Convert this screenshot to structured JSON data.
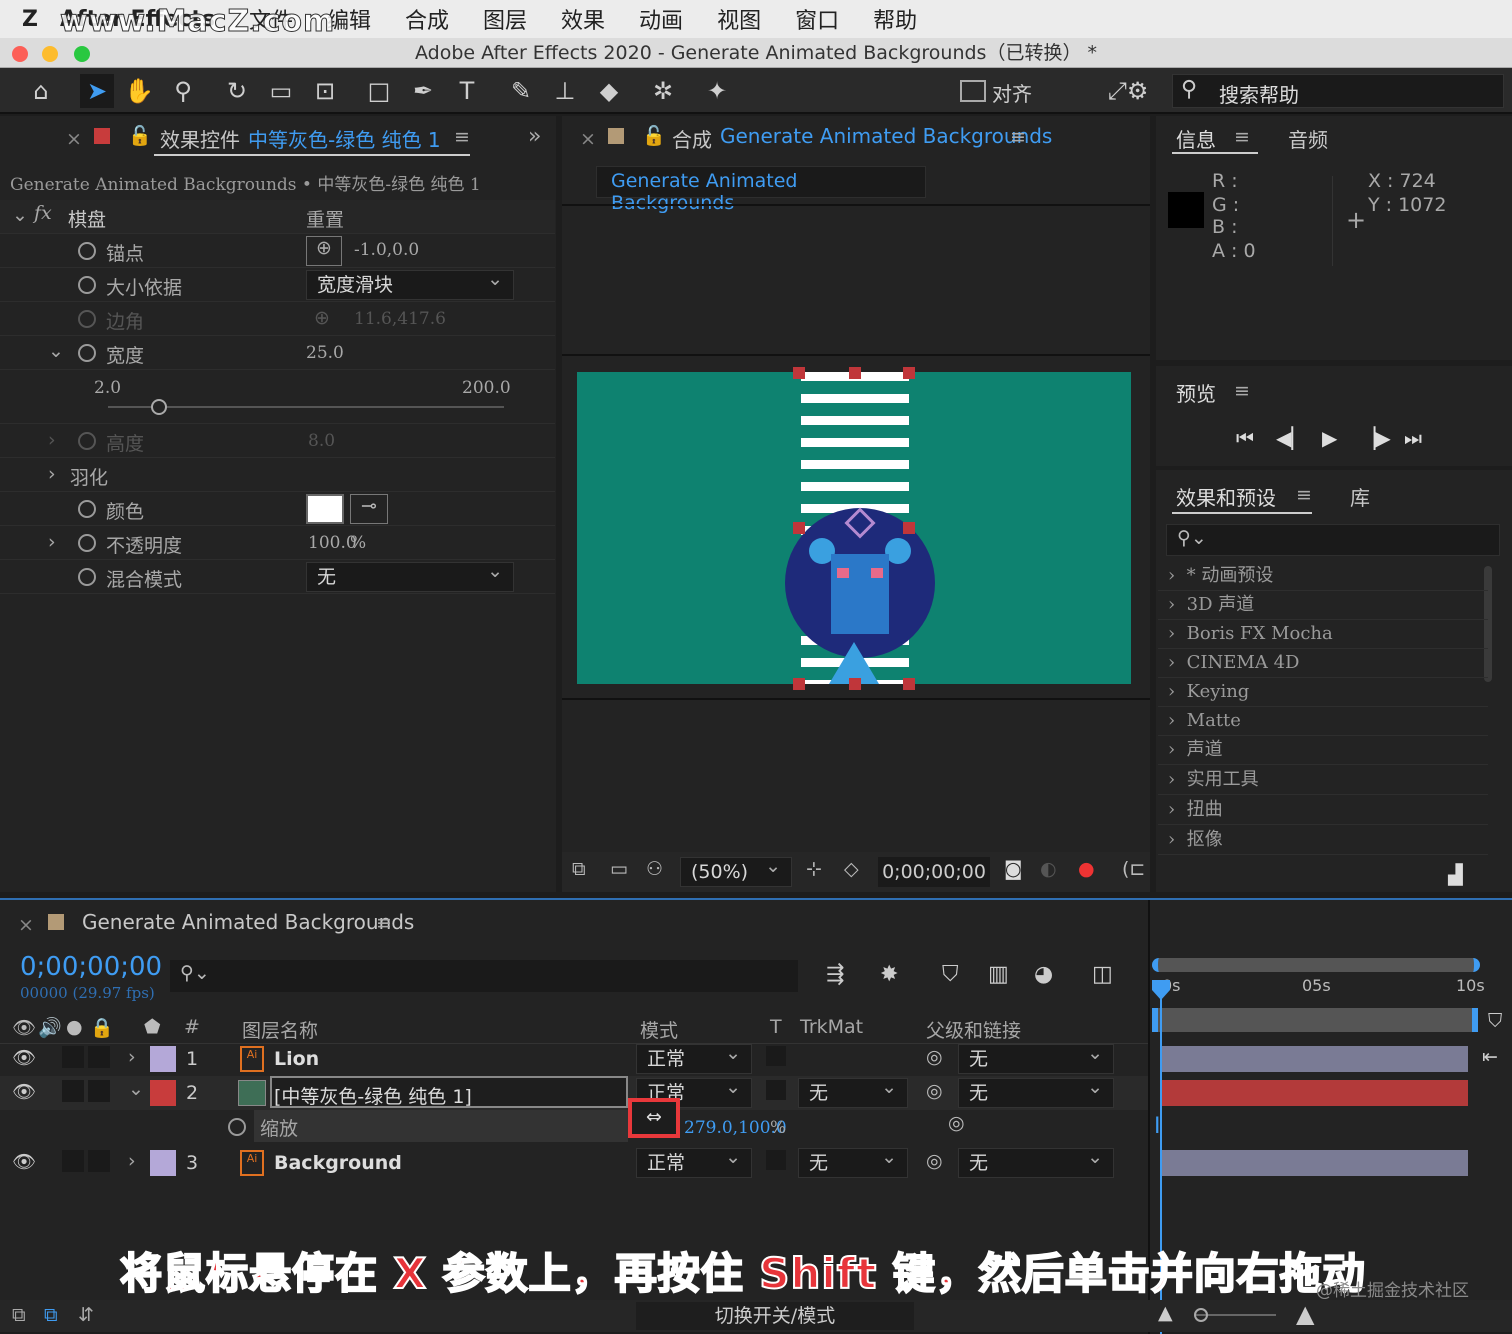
{
  "menubar": {
    "app": "After Effects",
    "items": [
      "文件",
      "编辑",
      "合成",
      "图层",
      "效果",
      "动画",
      "视图",
      "窗口",
      "帮助"
    ],
    "watermark": "www.MacZ.com"
  },
  "window": {
    "title": "Adobe After Effects 2020 - Generate Animated Backgrounds（已转换） *"
  },
  "toolbar": {
    "align_label": "对齐",
    "search_label": "搜索帮助"
  },
  "effect_controls": {
    "tab_prefix": "效果控件",
    "tab_layer": "中等灰色-绿色 纯色 1",
    "breadcrumb": "Generate Animated Backgrounds • 中等灰色-绿色 纯色 1",
    "effect_name": "棋盘",
    "reset": "重置",
    "props": {
      "anchor": {
        "label": "锚点",
        "value": "-1.0,0.0"
      },
      "size_from": {
        "label": "大小依据",
        "value": "宽度滑块"
      },
      "corner": {
        "label": "边角",
        "value": "11.6,417.6"
      },
      "width": {
        "label": "宽度",
        "value": "25.0",
        "min": "2.0",
        "max": "200.0",
        "slider_fraction": 0.13
      },
      "height": {
        "label": "高度",
        "value": "8.0"
      },
      "feather": {
        "label": "羽化"
      },
      "color": {
        "label": "颜色"
      },
      "opacity": {
        "label": "不透明度",
        "value": "100.0",
        "unit": "%"
      },
      "blend": {
        "label": "混合模式",
        "value": "无"
      }
    }
  },
  "composition": {
    "tab_prefix": "合成",
    "tab_name": "Generate Animated Backgrounds",
    "subtab": "Generate Animated Backgrounds",
    "zoom": "(50%)",
    "timecode": "0;00;00;00"
  },
  "info": {
    "tab": "信息",
    "tab2": "音频",
    "r": "R :",
    "g": "G :",
    "b": "B :",
    "a": "A :  0",
    "x": "X : 724",
    "y": "Y : 1072"
  },
  "preview": {
    "title": "预览"
  },
  "effects_presets": {
    "title": "效果和预设",
    "tab2": "库",
    "items": [
      "* 动画预设",
      "3D 声道",
      "Boris FX Mocha",
      "CINEMA 4D",
      "Keying",
      "Matte",
      "声道",
      "实用工具",
      "扭曲",
      "抠像"
    ]
  },
  "timeline": {
    "comp_name": "Generate Animated Backgrounds",
    "timecode": "0;00;00;00",
    "frames": "00000 (29.97 fps)",
    "headers": {
      "num": "#",
      "layer_name": "图层名称",
      "mode": "模式",
      "t": "T",
      "trkmat": "TrkMat",
      "parent": "父级和链接"
    },
    "ruler": [
      "0s",
      "05s",
      "10s"
    ],
    "layers": [
      {
        "num": "1",
        "name": "Lion",
        "mode": "正常",
        "trkmat": "",
        "parent": "无"
      },
      {
        "num": "2",
        "name": "[中等灰色-绿色 纯色 1]",
        "mode": "正常",
        "trkmat": "无",
        "parent": "无"
      },
      {
        "num": "3",
        "name": "Background",
        "mode": "正常",
        "trkmat": "无",
        "parent": "无"
      }
    ],
    "scale": {
      "label": "缩放",
      "value": "279.0,100.0",
      "unit": "%"
    },
    "footer": "切换开关/模式"
  },
  "caption": "将鼠标悬停在 X 参数上，再按住 Shift 键，然后单击并向右拖动",
  "credit": "@稀土掘金技术社区",
  "colors": {
    "accent": "#3f9cf2",
    "comp_bg": "#0e8270",
    "layer2_color": "#c83c3c",
    "lion_circle": "#1e2a7a",
    "highlight": "#e8383b"
  }
}
